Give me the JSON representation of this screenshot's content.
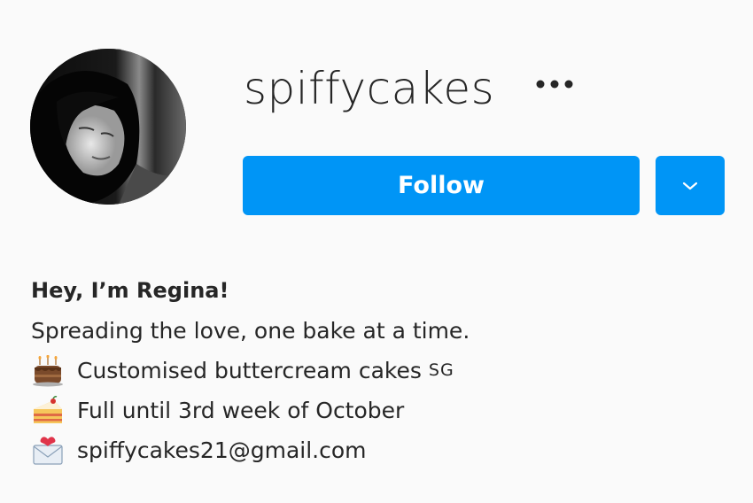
{
  "profile": {
    "username": "spiffycakes",
    "follow_label": "Follow",
    "more_icon": "more-horizontal-icon",
    "dropdown_icon": "chevron-down-icon"
  },
  "bio": {
    "name": "Hey, I’m Regina!",
    "tagline": "Spreading the love, one bake at a time.",
    "lines": [
      {
        "icon": "cake-emoji-icon",
        "text": "Customised buttercream cakes",
        "suffix": "SG"
      },
      {
        "icon": "cake-slice-emoji-icon",
        "text": "Full until 3rd week of October"
      },
      {
        "icon": "envelope-heart-emoji-icon",
        "text": "spiffycakes21@gmail.com"
      }
    ]
  },
  "colors": {
    "accent": "#0095f6",
    "background": "#fafafa",
    "text": "#262626"
  }
}
